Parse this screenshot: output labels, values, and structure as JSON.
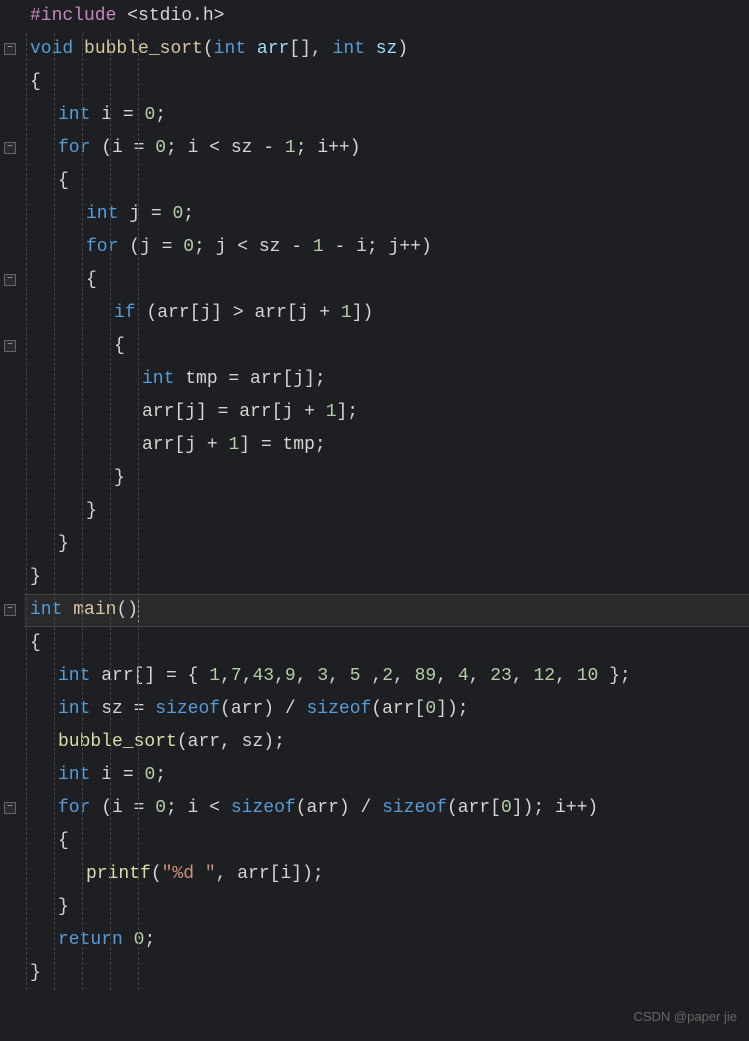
{
  "watermark": "CSDN @paper jie",
  "fold_positions": [
    1,
    4,
    8,
    10,
    18,
    24
  ],
  "code": {
    "lines": [
      {
        "indent": 0,
        "tokens": [
          {
            "t": "#include ",
            "c": "c-directive"
          },
          {
            "t": "<stdio.h>",
            "c": "c-include"
          }
        ]
      },
      {
        "indent": 0,
        "tokens": [
          {
            "t": "void",
            "c": "c-keyword"
          },
          {
            "t": " ",
            "c": ""
          },
          {
            "t": "bubble_sort",
            "c": "c-funcdef"
          },
          {
            "t": "(",
            "c": "c-punct"
          },
          {
            "t": "int",
            "c": "c-type"
          },
          {
            "t": " ",
            "c": ""
          },
          {
            "t": "arr",
            "c": "c-param"
          },
          {
            "t": "[], ",
            "c": "c-punct"
          },
          {
            "t": "int",
            "c": "c-type"
          },
          {
            "t": " ",
            "c": ""
          },
          {
            "t": "sz",
            "c": "c-param"
          },
          {
            "t": ")",
            "c": "c-punct"
          }
        ]
      },
      {
        "indent": 0,
        "tokens": [
          {
            "t": "{",
            "c": "c-punct"
          }
        ]
      },
      {
        "indent": 1,
        "tokens": [
          {
            "t": "int",
            "c": "c-type"
          },
          {
            "t": " ",
            "c": ""
          },
          {
            "t": "i",
            "c": "c-var"
          },
          {
            "t": " = ",
            "c": "c-op"
          },
          {
            "t": "0",
            "c": "c-num"
          },
          {
            "t": ";",
            "c": "c-punct"
          }
        ]
      },
      {
        "indent": 1,
        "tokens": [
          {
            "t": "for",
            "c": "c-keyword"
          },
          {
            "t": " (",
            "c": "c-punct"
          },
          {
            "t": "i",
            "c": "c-var"
          },
          {
            "t": " = ",
            "c": "c-op"
          },
          {
            "t": "0",
            "c": "c-num"
          },
          {
            "t": "; ",
            "c": "c-punct"
          },
          {
            "t": "i",
            "c": "c-var"
          },
          {
            "t": " < ",
            "c": "c-op"
          },
          {
            "t": "sz",
            "c": "c-var"
          },
          {
            "t": " - ",
            "c": "c-op"
          },
          {
            "t": "1",
            "c": "c-num"
          },
          {
            "t": "; ",
            "c": "c-punct"
          },
          {
            "t": "i",
            "c": "c-var"
          },
          {
            "t": "++)",
            "c": "c-punct"
          }
        ]
      },
      {
        "indent": 1,
        "tokens": [
          {
            "t": "{",
            "c": "c-punct"
          }
        ]
      },
      {
        "indent": 2,
        "tokens": [
          {
            "t": "int",
            "c": "c-type"
          },
          {
            "t": " ",
            "c": ""
          },
          {
            "t": "j",
            "c": "c-var"
          },
          {
            "t": " = ",
            "c": "c-op"
          },
          {
            "t": "0",
            "c": "c-num"
          },
          {
            "t": ";",
            "c": "c-punct"
          }
        ]
      },
      {
        "indent": 2,
        "tokens": [
          {
            "t": "for",
            "c": "c-keyword"
          },
          {
            "t": " (",
            "c": "c-punct"
          },
          {
            "t": "j",
            "c": "c-var"
          },
          {
            "t": " = ",
            "c": "c-op"
          },
          {
            "t": "0",
            "c": "c-num"
          },
          {
            "t": "; ",
            "c": "c-punct"
          },
          {
            "t": "j",
            "c": "c-var"
          },
          {
            "t": " < ",
            "c": "c-op"
          },
          {
            "t": "sz",
            "c": "c-var"
          },
          {
            "t": " - ",
            "c": "c-op"
          },
          {
            "t": "1",
            "c": "c-num"
          },
          {
            "t": " - ",
            "c": "c-op"
          },
          {
            "t": "i",
            "c": "c-var"
          },
          {
            "t": "; ",
            "c": "c-punct"
          },
          {
            "t": "j",
            "c": "c-var"
          },
          {
            "t": "++)",
            "c": "c-punct"
          }
        ]
      },
      {
        "indent": 2,
        "tokens": [
          {
            "t": "{",
            "c": "c-punct"
          }
        ]
      },
      {
        "indent": 3,
        "tokens": [
          {
            "t": "if",
            "c": "c-keyword"
          },
          {
            "t": " (",
            "c": "c-punct"
          },
          {
            "t": "arr",
            "c": "c-var"
          },
          {
            "t": "[",
            "c": "c-punct"
          },
          {
            "t": "j",
            "c": "c-var"
          },
          {
            "t": "] > ",
            "c": "c-op"
          },
          {
            "t": "arr",
            "c": "c-var"
          },
          {
            "t": "[",
            "c": "c-punct"
          },
          {
            "t": "j",
            "c": "c-var"
          },
          {
            "t": " + ",
            "c": "c-op"
          },
          {
            "t": "1",
            "c": "c-num"
          },
          {
            "t": "])",
            "c": "c-punct"
          }
        ]
      },
      {
        "indent": 3,
        "tokens": [
          {
            "t": "{",
            "c": "c-punct"
          }
        ]
      },
      {
        "indent": 4,
        "tokens": [
          {
            "t": "int",
            "c": "c-type"
          },
          {
            "t": " ",
            "c": ""
          },
          {
            "t": "tmp",
            "c": "c-var"
          },
          {
            "t": " = ",
            "c": "c-op"
          },
          {
            "t": "arr",
            "c": "c-var"
          },
          {
            "t": "[",
            "c": "c-punct"
          },
          {
            "t": "j",
            "c": "c-var"
          },
          {
            "t": "];",
            "c": "c-punct"
          }
        ]
      },
      {
        "indent": 4,
        "tokens": [
          {
            "t": "arr",
            "c": "c-var"
          },
          {
            "t": "[",
            "c": "c-punct"
          },
          {
            "t": "j",
            "c": "c-var"
          },
          {
            "t": "] = ",
            "c": "c-op"
          },
          {
            "t": "arr",
            "c": "c-var"
          },
          {
            "t": "[",
            "c": "c-punct"
          },
          {
            "t": "j",
            "c": "c-var"
          },
          {
            "t": " + ",
            "c": "c-op"
          },
          {
            "t": "1",
            "c": "c-num"
          },
          {
            "t": "];",
            "c": "c-punct"
          }
        ]
      },
      {
        "indent": 4,
        "tokens": [
          {
            "t": "arr",
            "c": "c-var"
          },
          {
            "t": "[",
            "c": "c-punct"
          },
          {
            "t": "j",
            "c": "c-var"
          },
          {
            "t": " + ",
            "c": "c-op"
          },
          {
            "t": "1",
            "c": "c-num"
          },
          {
            "t": "] = ",
            "c": "c-op"
          },
          {
            "t": "tmp",
            "c": "c-var"
          },
          {
            "t": ";",
            "c": "c-punct"
          }
        ]
      },
      {
        "indent": 3,
        "tokens": [
          {
            "t": "}",
            "c": "c-punct"
          }
        ]
      },
      {
        "indent": 2,
        "tokens": [
          {
            "t": "}",
            "c": "c-punct"
          }
        ]
      },
      {
        "indent": 1,
        "tokens": [
          {
            "t": "}",
            "c": "c-punct"
          }
        ]
      },
      {
        "indent": 0,
        "tokens": [
          {
            "t": "}",
            "c": "c-punct"
          }
        ]
      },
      {
        "indent": 0,
        "highlighted": true,
        "cursor": true,
        "tokens": [
          {
            "t": "int",
            "c": "c-type"
          },
          {
            "t": " ",
            "c": ""
          },
          {
            "t": "main",
            "c": "c-funcdef"
          },
          {
            "t": "()",
            "c": "c-punct"
          }
        ]
      },
      {
        "indent": 0,
        "tokens": [
          {
            "t": "{",
            "c": "c-punct"
          }
        ]
      },
      {
        "indent": 1,
        "tokens": [
          {
            "t": "int",
            "c": "c-type"
          },
          {
            "t": " ",
            "c": ""
          },
          {
            "t": "arr",
            "c": "c-var"
          },
          {
            "t": "[] = { ",
            "c": "c-punct"
          },
          {
            "t": "1",
            "c": "c-num"
          },
          {
            "t": ",",
            "c": "c-punct"
          },
          {
            "t": "7",
            "c": "c-num"
          },
          {
            "t": ",",
            "c": "c-punct"
          },
          {
            "t": "43",
            "c": "c-num"
          },
          {
            "t": ",",
            "c": "c-punct"
          },
          {
            "t": "9",
            "c": "c-num"
          },
          {
            "t": ", ",
            "c": "c-punct"
          },
          {
            "t": "3",
            "c": "c-num"
          },
          {
            "t": ", ",
            "c": "c-punct"
          },
          {
            "t": "5",
            "c": "c-num"
          },
          {
            "t": " ,",
            "c": "c-punct"
          },
          {
            "t": "2",
            "c": "c-num"
          },
          {
            "t": ", ",
            "c": "c-punct"
          },
          {
            "t": "89",
            "c": "c-num"
          },
          {
            "t": ", ",
            "c": "c-punct"
          },
          {
            "t": "4",
            "c": "c-num"
          },
          {
            "t": ", ",
            "c": "c-punct"
          },
          {
            "t": "23",
            "c": "c-num"
          },
          {
            "t": ", ",
            "c": "c-punct"
          },
          {
            "t": "12",
            "c": "c-num"
          },
          {
            "t": ", ",
            "c": "c-punct"
          },
          {
            "t": "10",
            "c": "c-num"
          },
          {
            "t": " };",
            "c": "c-punct"
          }
        ]
      },
      {
        "indent": 1,
        "tokens": [
          {
            "t": "int",
            "c": "c-type"
          },
          {
            "t": " ",
            "c": ""
          },
          {
            "t": "sz",
            "c": "c-var"
          },
          {
            "t": " = ",
            "c": "c-op"
          },
          {
            "t": "sizeof",
            "c": "c-sizeof"
          },
          {
            "t": "(",
            "c": "c-punct"
          },
          {
            "t": "arr",
            "c": "c-var"
          },
          {
            "t": ") / ",
            "c": "c-op"
          },
          {
            "t": "sizeof",
            "c": "c-sizeof"
          },
          {
            "t": "(",
            "c": "c-punct"
          },
          {
            "t": "arr",
            "c": "c-var"
          },
          {
            "t": "[",
            "c": "c-punct"
          },
          {
            "t": "0",
            "c": "c-num"
          },
          {
            "t": "]);",
            "c": "c-punct"
          }
        ]
      },
      {
        "indent": 1,
        "tokens": [
          {
            "t": "bubble_sort",
            "c": "c-func"
          },
          {
            "t": "(",
            "c": "c-punct"
          },
          {
            "t": "arr",
            "c": "c-var"
          },
          {
            "t": ", ",
            "c": "c-punct"
          },
          {
            "t": "sz",
            "c": "c-var"
          },
          {
            "t": ");",
            "c": "c-punct"
          }
        ]
      },
      {
        "indent": 1,
        "tokens": [
          {
            "t": "int",
            "c": "c-type"
          },
          {
            "t": " ",
            "c": ""
          },
          {
            "t": "i",
            "c": "c-var"
          },
          {
            "t": " = ",
            "c": "c-op"
          },
          {
            "t": "0",
            "c": "c-num"
          },
          {
            "t": ";",
            "c": "c-punct"
          }
        ]
      },
      {
        "indent": 1,
        "tokens": [
          {
            "t": "for",
            "c": "c-keyword"
          },
          {
            "t": " (",
            "c": "c-punct"
          },
          {
            "t": "i",
            "c": "c-var"
          },
          {
            "t": " = ",
            "c": "c-op"
          },
          {
            "t": "0",
            "c": "c-num"
          },
          {
            "t": "; ",
            "c": "c-punct"
          },
          {
            "t": "i",
            "c": "c-var"
          },
          {
            "t": " < ",
            "c": "c-op"
          },
          {
            "t": "sizeof",
            "c": "c-sizeof"
          },
          {
            "t": "(",
            "c": "c-punct"
          },
          {
            "t": "arr",
            "c": "c-var"
          },
          {
            "t": ") / ",
            "c": "c-op"
          },
          {
            "t": "sizeof",
            "c": "c-sizeof"
          },
          {
            "t": "(",
            "c": "c-punct"
          },
          {
            "t": "arr",
            "c": "c-var"
          },
          {
            "t": "[",
            "c": "c-punct"
          },
          {
            "t": "0",
            "c": "c-num"
          },
          {
            "t": "]); ",
            "c": "c-punct"
          },
          {
            "t": "i",
            "c": "c-var"
          },
          {
            "t": "++)",
            "c": "c-punct"
          }
        ]
      },
      {
        "indent": 1,
        "tokens": [
          {
            "t": "{",
            "c": "c-punct"
          }
        ]
      },
      {
        "indent": 2,
        "tokens": [
          {
            "t": "printf",
            "c": "c-func"
          },
          {
            "t": "(",
            "c": "c-punct"
          },
          {
            "t": "\"%d \"",
            "c": "c-str"
          },
          {
            "t": ", ",
            "c": "c-punct"
          },
          {
            "t": "arr",
            "c": "c-var"
          },
          {
            "t": "[",
            "c": "c-punct"
          },
          {
            "t": "i",
            "c": "c-var"
          },
          {
            "t": "]);",
            "c": "c-punct"
          }
        ]
      },
      {
        "indent": 1,
        "tokens": [
          {
            "t": "}",
            "c": "c-punct"
          }
        ]
      },
      {
        "indent": 1,
        "tokens": [
          {
            "t": "return",
            "c": "c-keyword"
          },
          {
            "t": " ",
            "c": ""
          },
          {
            "t": "0",
            "c": "c-num"
          },
          {
            "t": ";",
            "c": "c-punct"
          }
        ]
      },
      {
        "indent": 0,
        "tokens": [
          {
            "t": "}",
            "c": "c-punct"
          }
        ]
      }
    ]
  }
}
